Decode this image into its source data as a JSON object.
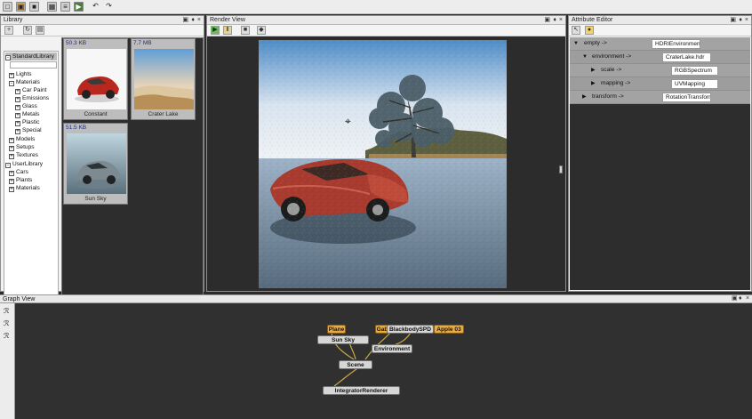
{
  "toolbar": {
    "icons": [
      "new-icon",
      "open-icon",
      "save-icon",
      "grid-icon",
      "settings-icon",
      "terminal-icon",
      "undo-icon",
      "redo-icon"
    ]
  },
  "library": {
    "title": "Library",
    "tree": [
      {
        "label": "StandardLibrary",
        "state": "-"
      },
      {
        "label": "",
        "state": ""
      },
      {
        "label": "Lights",
        "state": "+"
      },
      {
        "label": "Materials",
        "state": "-"
      },
      {
        "label": "Car Paint",
        "state": "+"
      },
      {
        "label": "Emissions",
        "state": "+"
      },
      {
        "label": "Glass",
        "state": "+"
      },
      {
        "label": "Metals",
        "state": "+"
      },
      {
        "label": "Plastic",
        "state": "+"
      },
      {
        "label": "Special",
        "state": "+"
      },
      {
        "label": "Models",
        "state": "+"
      },
      {
        "label": "Setups",
        "state": "+"
      },
      {
        "label": "Textures",
        "state": "+"
      },
      {
        "label": "UserLibrary",
        "state": "-"
      },
      {
        "label": "Cars",
        "state": "+"
      },
      {
        "label": "Plants",
        "state": "+"
      },
      {
        "label": "Materials",
        "state": "+"
      }
    ],
    "thumbs": [
      {
        "size": "50.3 KB",
        "label": "Constant"
      },
      {
        "size": "7.7 MB",
        "label": "Crater Lake"
      },
      {
        "size": "51.5 KB",
        "label": "Sun Sky"
      }
    ]
  },
  "render": {
    "title": "Render View"
  },
  "attributes": {
    "title": "Attribute Editor",
    "rows": [
      {
        "label": "empty ->",
        "value": "HDRIEnvironment"
      },
      {
        "label": "environment ->",
        "value": "CraterLake.hdr"
      },
      {
        "label": "scale ->",
        "value": "RGBSpectrum"
      },
      {
        "label": "mapping ->",
        "value": "UVMapping"
      },
      {
        "label": "transform ->",
        "value": "RotationTransform"
      }
    ]
  },
  "graph": {
    "title": "Graph View",
    "nodes": [
      {
        "label": "Plane",
        "kind": "orange"
      },
      {
        "label": "Sun Sky",
        "kind": "light"
      },
      {
        "label": "Gab",
        "kind": "orange"
      },
      {
        "label": "BlackbodySPD",
        "kind": "light"
      },
      {
        "label": "Apple 03",
        "kind": "orange"
      },
      {
        "label": "Environment",
        "kind": "light"
      },
      {
        "label": "Scene",
        "kind": "light"
      },
      {
        "label": "IntegratorRenderer",
        "kind": "light"
      }
    ]
  }
}
